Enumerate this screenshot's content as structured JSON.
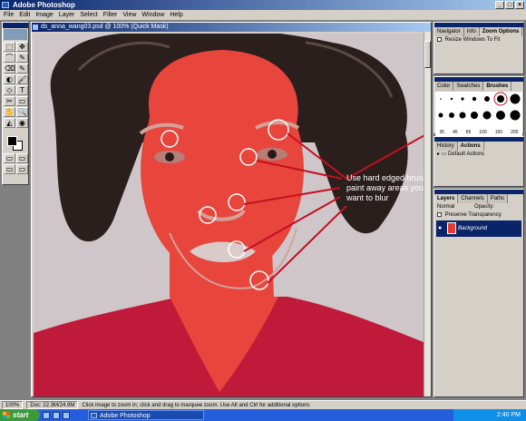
{
  "app": {
    "title": "Adobe Photoshop",
    "menu": [
      "File",
      "Edit",
      "Image",
      "Layer",
      "Select",
      "Filter",
      "View",
      "Window",
      "Help"
    ]
  },
  "toolbox": {
    "tools": [
      "⬚",
      "✥",
      "⌒",
      "✎",
      "⌫",
      "✎",
      "◐",
      "🖌",
      "◇",
      "T",
      "✂",
      "▭",
      "✋",
      "🔍",
      "◭",
      "◉",
      "▭",
      "▭",
      "▭",
      "▭"
    ],
    "foreground_color": "#000000",
    "background_color": "#ffffff"
  },
  "document": {
    "title": "ds_anna_wang03.psd @ 100% (Quick Mask)",
    "annotation": "Use hard edged brushes to paint away areas you don't want to blur"
  },
  "palettes": {
    "navigator": {
      "tabs": [
        "Navigator",
        "Info",
        "Zoom Options"
      ],
      "option_label": "Resize Windows To Fit"
    },
    "brushes": {
      "tabs": [
        "Color",
        "Swatches",
        "Brushes"
      ],
      "size_labels": [
        "35",
        "45",
        "65",
        "100",
        "150",
        "200"
      ]
    },
    "actions": {
      "tabs": [
        "History",
        "Actions"
      ],
      "set_name": "Default Actions"
    },
    "layers": {
      "tabs": [
        "Layers",
        "Channels",
        "Paths"
      ],
      "blend_mode": "Normal",
      "opacity_label": "Opacity:",
      "preserve_label": "Preserve Transparency",
      "layer_name": "Background"
    }
  },
  "status": {
    "zoom": "100%",
    "doc": "Doc: 22.3M/24.9M",
    "hint": "Click image to zoom in; click and drag to marquee zoom. Use Alt and Ctrl for additional options"
  },
  "taskbar": {
    "start_label": "start",
    "task_label": "Adobe Photoshop",
    "clock": "2:40 PM"
  },
  "colors": {
    "quickmask": "#e8453c",
    "titlebar": "#0a246a",
    "chrome": "#d4d0c8"
  }
}
